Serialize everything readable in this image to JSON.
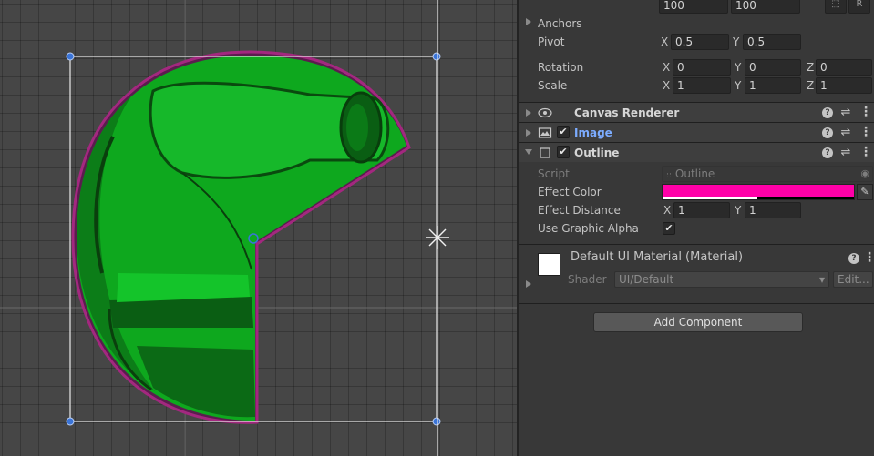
{
  "inspector": {
    "top_fields": {
      "width_value": "100",
      "height_value": "100",
      "blueprint_btn": "⬚",
      "raw_btn": "R"
    },
    "anchors_label": "Anchors",
    "pivot": {
      "label": "Pivot",
      "x_axis": "X",
      "x": "0.5",
      "y_axis": "Y",
      "y": "0.5"
    },
    "rotation": {
      "label": "Rotation",
      "x_axis": "X",
      "x": "0",
      "y_axis": "Y",
      "y": "0",
      "z_axis": "Z",
      "z": "0"
    },
    "scale": {
      "label": "Scale",
      "x_axis": "X",
      "x": "1",
      "y_axis": "Y",
      "y": "1",
      "z_axis": "Z",
      "z": "1"
    },
    "components": {
      "canvas_renderer": {
        "title": "Canvas Renderer",
        "icon": "eye-icon"
      },
      "image": {
        "title": "Image",
        "icon": "image-icon",
        "enabled": "✔"
      },
      "outline": {
        "title": "Outline",
        "icon": "script-icon",
        "enabled": "✔"
      }
    },
    "outline_props": {
      "script_label": "Script",
      "script_value": "Outline",
      "effect_color_label": "Effect Color",
      "effect_color": "#ff00a8",
      "effect_distance_label": "Effect Distance",
      "dist_x_axis": "X",
      "dist_x": "1",
      "dist_y_axis": "Y",
      "dist_y": "1",
      "use_graphic_alpha_label": "Use Graphic Alpha",
      "use_graphic_alpha": "✔"
    },
    "material": {
      "name": "Default UI Material (Material)",
      "shader_label": "Shader",
      "shader_value": "UI/Default",
      "edit_label": "Edit..."
    },
    "add_component_label": "Add Component",
    "glyphs": {
      "help": "?",
      "presets": "⇌",
      "menu": "⋮",
      "picker": "✎",
      "target": "◉",
      "script_dots": "::",
      "dropdown_arrow": "▾"
    }
  },
  "colors": {
    "sprite_green": "#0ea81e",
    "sprite_dark": "#0b5a12",
    "outline_magenta": "#ff00a8",
    "link_blue": "#7cacff"
  }
}
